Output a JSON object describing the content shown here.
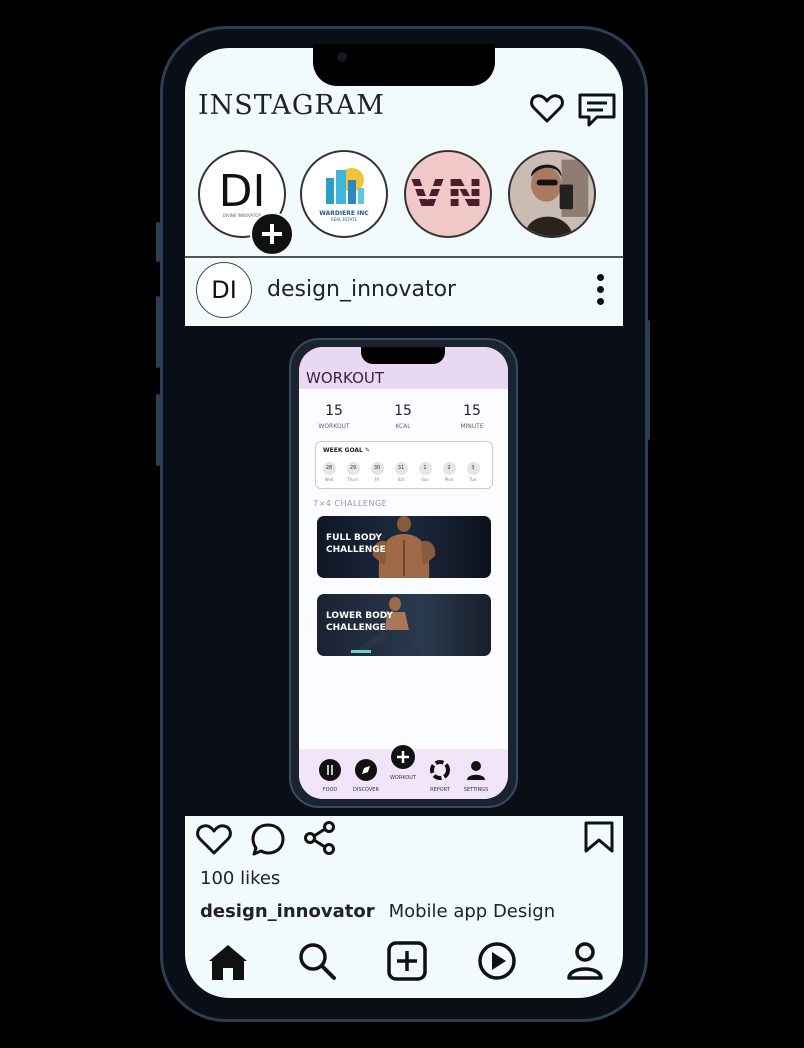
{
  "app": {
    "title": "INSTAGRAM",
    "accent": "#000000",
    "background": "#f1fbfc"
  },
  "header": {
    "icons": [
      "heart-icon",
      "messages-icon"
    ]
  },
  "stories": [
    {
      "label": "DI",
      "sub": "DIVINE INNOVATOR",
      "has_add": true
    },
    {
      "label": "",
      "sub": "WARDIERE INC",
      "sub2": "REAL ESTATE"
    },
    {
      "label": "VN"
    },
    {
      "label": ""
    }
  ],
  "post": {
    "avatar_label": "DI",
    "username": "design_innovator",
    "likes": "100 likes",
    "caption_user": "design_innovator",
    "caption_text": "Mobile app Design"
  },
  "mockup": {
    "title": "WORKOUT",
    "stats": [
      {
        "value": "15",
        "label": "WORKOUT"
      },
      {
        "value": "15",
        "label": "KCAL"
      },
      {
        "value": "15",
        "label": "MINUTE"
      }
    ],
    "goal_title": "WEEK GOAL",
    "days": [
      {
        "num": "28",
        "lbl": "Wed"
      },
      {
        "num": "29",
        "lbl": "Thurs"
      },
      {
        "num": "30",
        "lbl": "Fri"
      },
      {
        "num": "31",
        "lbl": "Sat"
      },
      {
        "num": "1",
        "lbl": "Sun"
      },
      {
        "num": "2",
        "lbl": "Mon"
      },
      {
        "num": "3",
        "lbl": "Tue"
      }
    ],
    "challenge_heading": "7×4 CHALLENGE",
    "challenges": [
      {
        "line1": "FULL BODY",
        "line2": "CHALLENGE"
      },
      {
        "line1": "LOWER BODY",
        "line2": "CHALLENGE"
      }
    ],
    "nav": [
      "FOOD",
      "DISCOVER",
      "WORKOUT",
      "REPORT",
      "SETTINGS"
    ]
  },
  "bottom_nav": [
    "home-icon",
    "search-icon",
    "add-post-icon",
    "reels-icon",
    "profile-icon"
  ]
}
